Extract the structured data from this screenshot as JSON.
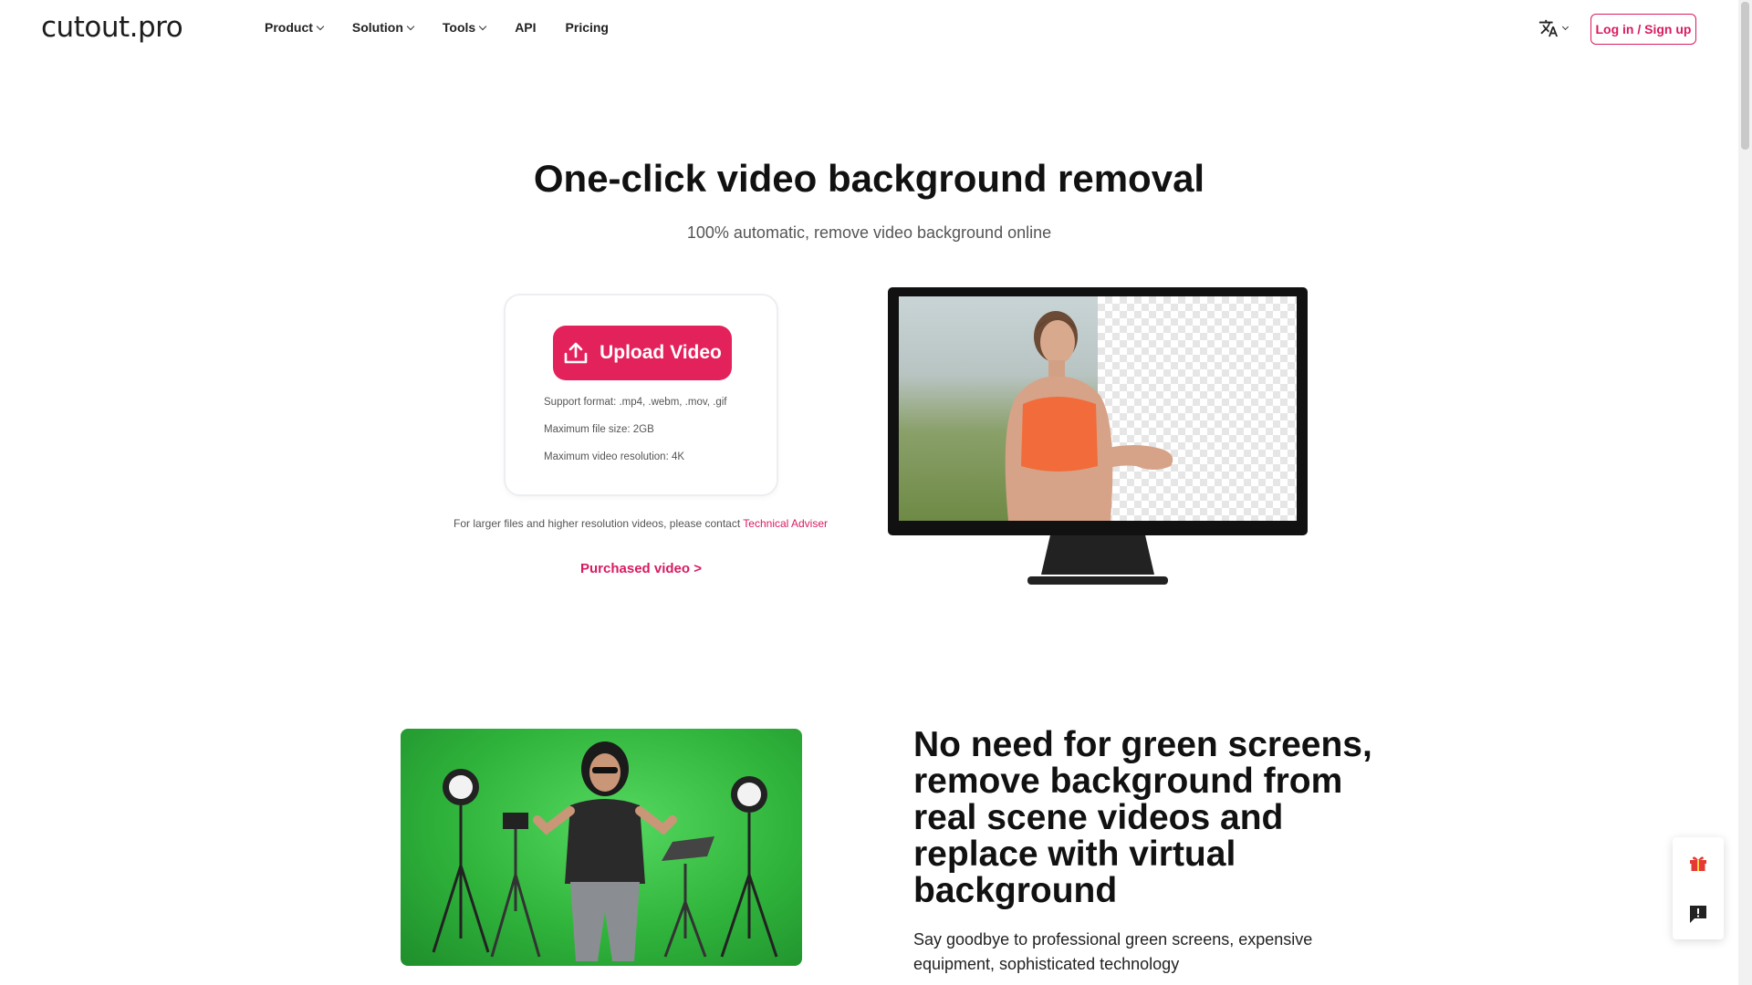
{
  "header": {
    "logo": "cutout.pro",
    "nav": [
      {
        "label": "Product",
        "has_dropdown": true
      },
      {
        "label": "Solution",
        "has_dropdown": true
      },
      {
        "label": "Tools",
        "has_dropdown": true
      },
      {
        "label": "API",
        "has_dropdown": false
      },
      {
        "label": "Pricing",
        "has_dropdown": false
      }
    ],
    "language_icon": "translate-icon",
    "login_label": "Log in / Sign up"
  },
  "hero": {
    "title": "One-click video background removal",
    "subtitle": "100% automatic, remove video background online",
    "upload_label": "Upload Video",
    "info": [
      "Support format: .mp4, .webm, .mov, .gif",
      "Maximum file size: 2GB",
      "Maximum video resolution: 4K"
    ],
    "contact_text": "For larger files and higher resolution videos, please contact",
    "contact_link": "Technical Adviser",
    "purchased_label": "Purchased video >"
  },
  "section2": {
    "title": "No need for green screens, remove background from real scene videos and replace with virtual background",
    "text": "Say goodbye to professional green screens, expensive equipment, sophisticated technology"
  },
  "floating": {
    "icons": [
      "gift-icon",
      "feedback-icon"
    ]
  },
  "colors": {
    "accent": "#e3225c",
    "link": "#d81b60"
  }
}
